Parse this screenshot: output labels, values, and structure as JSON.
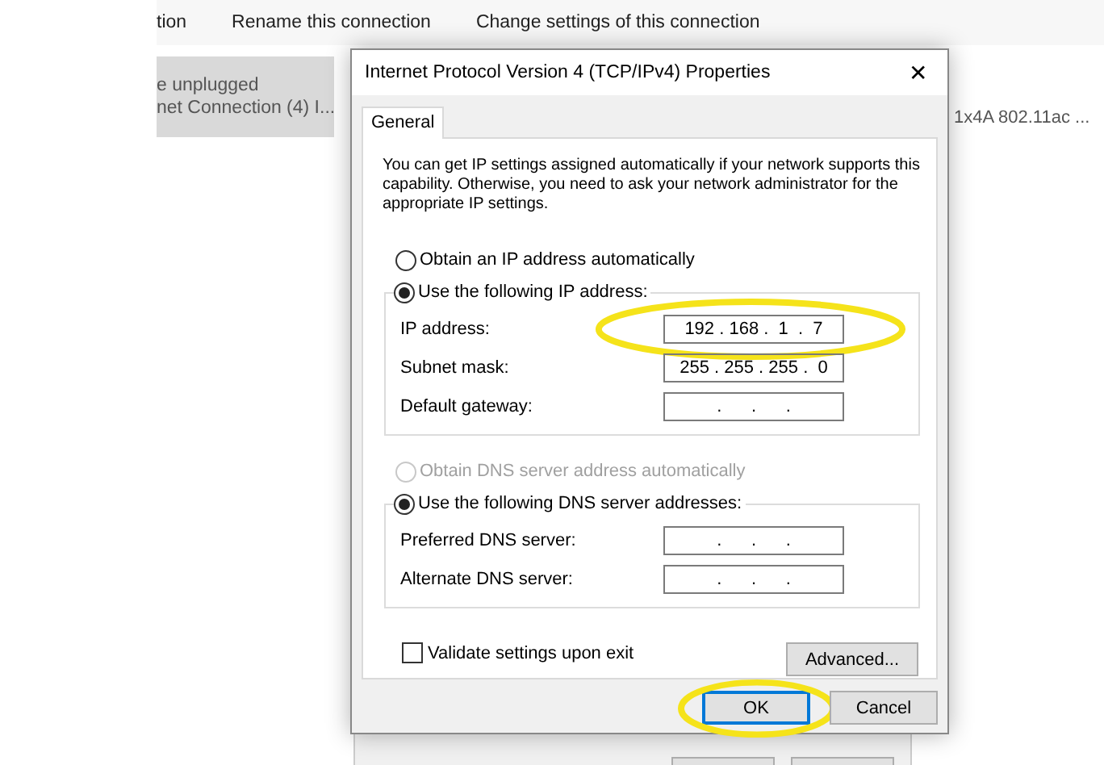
{
  "background": {
    "toolbar": [
      "tion",
      "Rename this connection",
      "Change settings of this connection"
    ],
    "selected_item": {
      "status": "e unplugged",
      "name": "net Connection (4) I..."
    },
    "device_text": "1x4A 802.11ac ..."
  },
  "dialog": {
    "title": "Internet Protocol Version 4 (TCP/IPv4) Properties",
    "close": "✕",
    "tabs": [
      {
        "label": "General",
        "selected": true
      }
    ],
    "description": "You can get IP settings assigned automatically if your network supports this capability. Otherwise, you need to ask your network administrator for the appropriate IP settings.",
    "ip_auto": {
      "label": "Obtain an IP address automatically",
      "selected": false,
      "disabled": false
    },
    "ip_manual": {
      "label": "Use the following IP address:",
      "selected": true,
      "disabled": false
    },
    "ip_fields": [
      {
        "label": "IP address:",
        "value": "192 . 168 .  1  .  7",
        "highlighted": true
      },
      {
        "label": "Subnet mask:",
        "value": "255 . 255 . 255 .  0",
        "highlighted": false
      },
      {
        "label": "Default gateway:",
        "value": ".      .      .",
        "highlighted": false
      }
    ],
    "dns_auto": {
      "label": "Obtain DNS server address automatically",
      "selected": false,
      "disabled": true
    },
    "dns_manual": {
      "label": "Use the following DNS server addresses:",
      "selected": true,
      "disabled": false
    },
    "dns_fields": [
      {
        "label": "Preferred DNS server:",
        "value": ".      .      .",
        "highlighted": false
      },
      {
        "label": "Alternate DNS server:",
        "value": ".      .      .",
        "highlighted": false
      }
    ],
    "validate": {
      "label": "Validate settings upon exit",
      "checked": false
    },
    "advanced_button": "Advanced...",
    "buttons": [
      {
        "label": "OK",
        "default": true,
        "highlighted": true
      },
      {
        "label": "Cancel",
        "default": false,
        "highlighted": false
      }
    ]
  }
}
